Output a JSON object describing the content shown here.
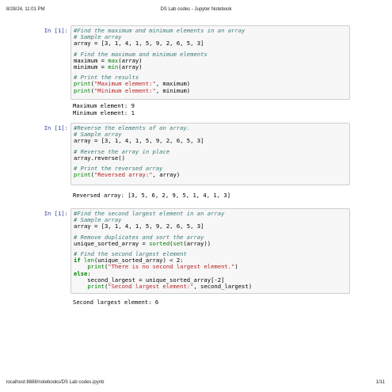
{
  "header": {
    "datetime": "8/28/24, 11:01 PM",
    "title": "DS Lab codes - Jupyter Notebook"
  },
  "footer": {
    "url": "localhost:8888/notebooks/DS Lab codes.ipynb",
    "page": "1/11"
  },
  "cells": [
    {
      "prompt": "In [1]:",
      "code": {
        "l1": "#Find the maximum and minimum elements in an array",
        "l2": "# Sample array",
        "l3a": "array = [3, 1, 4, 1, 5, 9, 2, 6, 5, 3]",
        "l4": "# Find the maximum and minimum elements",
        "l5a": "maximum = ",
        "l5b": "max",
        "l5c": "(array)",
        "l6a": "minimum = ",
        "l6b": "min",
        "l6c": "(array)",
        "l7": "# Print the results",
        "l8a": "print",
        "l8b": "(",
        "l8c": "\"Maximum element:\"",
        "l8d": ", maximum)",
        "l9a": "print",
        "l9b": "(",
        "l9c": "\"Minimum element:\"",
        "l9d": ", minimum)"
      },
      "output": [
        "Maximum element: 9",
        "Minimum element: 1"
      ]
    },
    {
      "prompt": "In [1]:",
      "code": {
        "l1": "#Reverse the elements of an array.",
        "l2": "# Sample array",
        "l3a": "array = [3, 1, 4, 1, 5, 9, 2, 6, 5, 3]",
        "l4": "# Reverse the array in place",
        "l5a": "array.reverse()",
        "l6": "# Print the reversed array",
        "l7a": "print",
        "l7b": "(",
        "l7c": "\"Reversed array:\"",
        "l7d": ", array)"
      },
      "output": [
        "Reversed array: [3, 5, 6, 2, 9, 5, 1, 4, 1, 3]"
      ]
    },
    {
      "prompt": "In [1]:",
      "code": {
        "l1": "#Find the second largest element in an array",
        "l2": "# Sample array",
        "l3a": "array = [3, 1, 4, 1, 5, 9, 2, 6, 5, 3]",
        "l4": "# Remove duplicates and sort the array",
        "l5a": "unique_sorted_array = ",
        "l5b": "sorted",
        "l5c": "(",
        "l5d": "set",
        "l5e": "(array))",
        "l6": "# Find the second largest element",
        "l7a": "if",
        "l7b": " ",
        "l7c": "len",
        "l7d": "(unique_sorted_array) < 2:",
        "l8a": "    ",
        "l8b": "print",
        "l8c": "(",
        "l8d": "\"There is no second largest element.\"",
        "l8e": ")",
        "l9a": "else",
        "l9b": ":",
        "l10a": "    second_largest = unique_sorted_array[-2]",
        "l11a": "    ",
        "l11b": "print",
        "l11c": "(",
        "l11d": "\"Second largest element:\"",
        "l11e": ", second_largest)"
      },
      "output": [
        "Second largest element: 6"
      ]
    }
  ]
}
